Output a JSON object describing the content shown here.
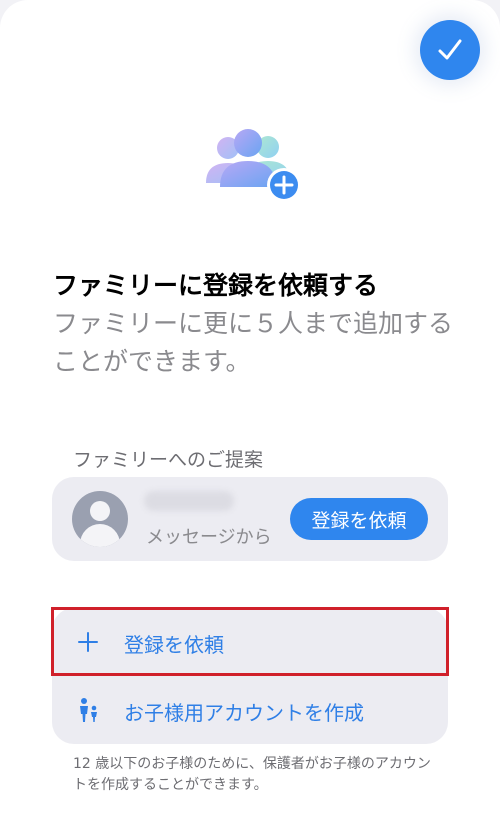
{
  "header": {
    "done_icon": "checkmark-icon",
    "accent": "#2f86ee"
  },
  "hero": {
    "icon": "family-add-icon",
    "title": "ファミリーに登録を依頼する",
    "subtitle": "ファミリーに更に５人まで追加することができます。"
  },
  "suggestions": {
    "label": "ファミリーへのご提案",
    "items": [
      {
        "avatar": "person-avatar-icon",
        "source": "メッセージから",
        "request_label": "登録を依頼"
      }
    ]
  },
  "actions": [
    {
      "icon": "plus-icon",
      "label": "登録を依頼"
    },
    {
      "icon": "child-adult-icon",
      "label": "お子様用アカウントを作成"
    }
  ],
  "footnote": "12 歳以下のお子様のために、保護者がお子様のアカウントを作成することができます。",
  "colors": {
    "link": "#2f7fe6",
    "highlight": "#d0202a"
  }
}
